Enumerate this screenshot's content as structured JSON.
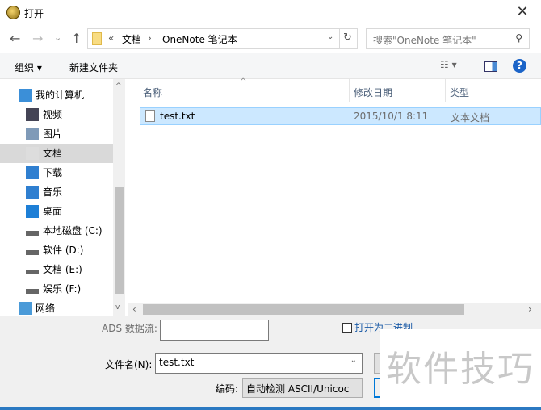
{
  "window": {
    "title": "打开",
    "close": "✕"
  },
  "nav": {
    "back": "←",
    "forward": "→",
    "recent": "⌄",
    "up": "↑",
    "breadcrumb": [
      "«",
      "文档",
      "›",
      "OneNote 笔记本"
    ],
    "search_placeholder": "搜索\"OneNote 笔记本\""
  },
  "toolbar": {
    "organize": "组织 ▾",
    "new_folder": "新建文件夹"
  },
  "sidebar": {
    "items": [
      {
        "label": "我的计算机",
        "icon": "computer-icon"
      },
      {
        "label": "视频",
        "icon": "video-icon"
      },
      {
        "label": "图片",
        "icon": "pictures-icon"
      },
      {
        "label": "文档",
        "icon": "documents-icon",
        "selected": true
      },
      {
        "label": "下载",
        "icon": "download-icon"
      },
      {
        "label": "音乐",
        "icon": "music-icon"
      },
      {
        "label": "桌面",
        "icon": "desktop-icon"
      },
      {
        "label": "本地磁盘 (C:)",
        "icon": "drive-icon"
      },
      {
        "label": "软件 (D:)",
        "icon": "drive-icon"
      },
      {
        "label": "文档 (E:)",
        "icon": "drive-icon"
      },
      {
        "label": "娱乐 (F:)",
        "icon": "drive-icon"
      },
      {
        "label": "网络",
        "icon": "network-icon"
      }
    ]
  },
  "list": {
    "columns": [
      "名称",
      "修改日期",
      "类型"
    ],
    "rows": [
      {
        "name": "test.txt",
        "date": "2015/10/1 8:11",
        "type": "文本文档"
      }
    ]
  },
  "bottom": {
    "ads_label": "ADS 数据流:",
    "ads_value": "",
    "binary_label": "打开为二进制",
    "filename_label": "文件名(N):",
    "filename_value": "test.txt",
    "encoding_label": "编码:",
    "encoding_value": "自动检测 ASCII/Unicoc"
  },
  "watermark": "软件技巧"
}
